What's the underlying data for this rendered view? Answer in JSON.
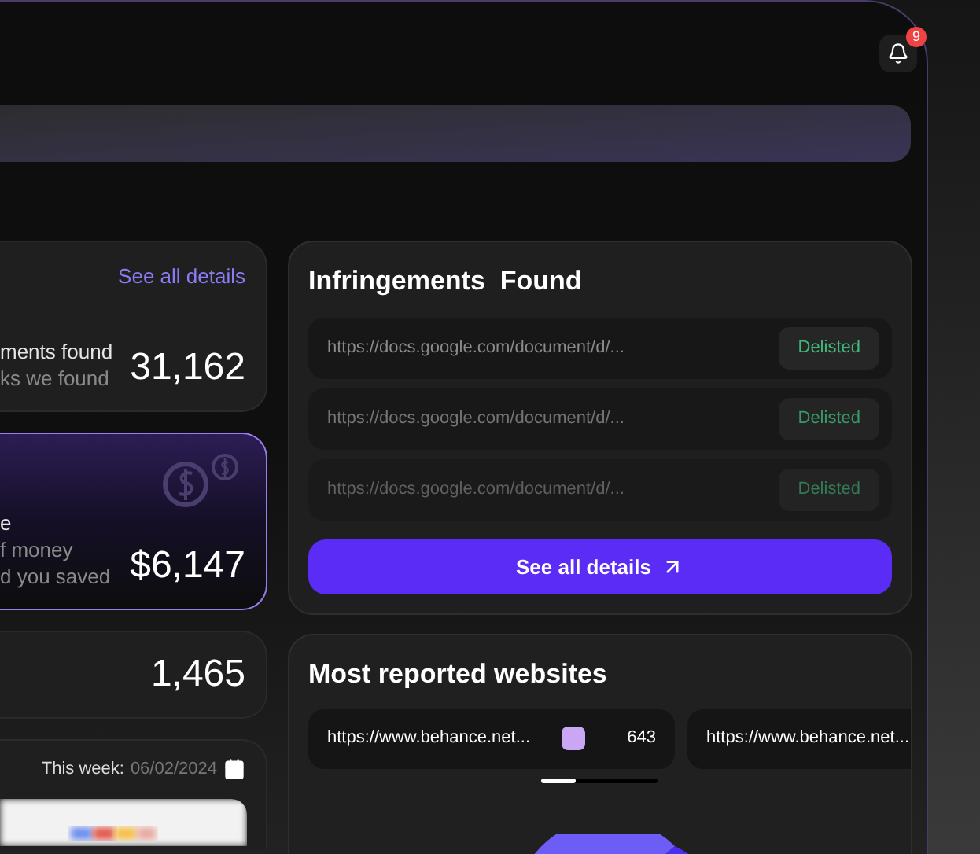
{
  "notifications": {
    "count": "9"
  },
  "stats": [
    {
      "highlighted": false,
      "link": "See all details",
      "title": "ments found",
      "description_lines": [
        "ks we found"
      ],
      "value": "31,162"
    },
    {
      "highlighted": true,
      "title": "e",
      "description_lines": [
        "f money",
        "d you saved"
      ],
      "value": "$6,147"
    },
    {
      "highlighted": false,
      "value": "1,465"
    }
  ],
  "week": {
    "label": "This week:",
    "date": "06/02/2024"
  },
  "infringements": {
    "title": "Infringements  Found",
    "rows": [
      {
        "url": "https://docs.google.com/document/d/...",
        "status": "Delisted"
      },
      {
        "url": "https://docs.google.com/document/d/...",
        "status": "Delisted"
      },
      {
        "url": "https://docs.google.com/document/d/...",
        "status": "Delisted"
      }
    ],
    "button": "See all details"
  },
  "websites": {
    "title": "Most reported websites",
    "items": [
      {
        "url": "https://www.behance.net...",
        "color": "#c9a7f5",
        "count": "643"
      },
      {
        "url": "https://www.behance.net..."
      }
    ]
  }
}
